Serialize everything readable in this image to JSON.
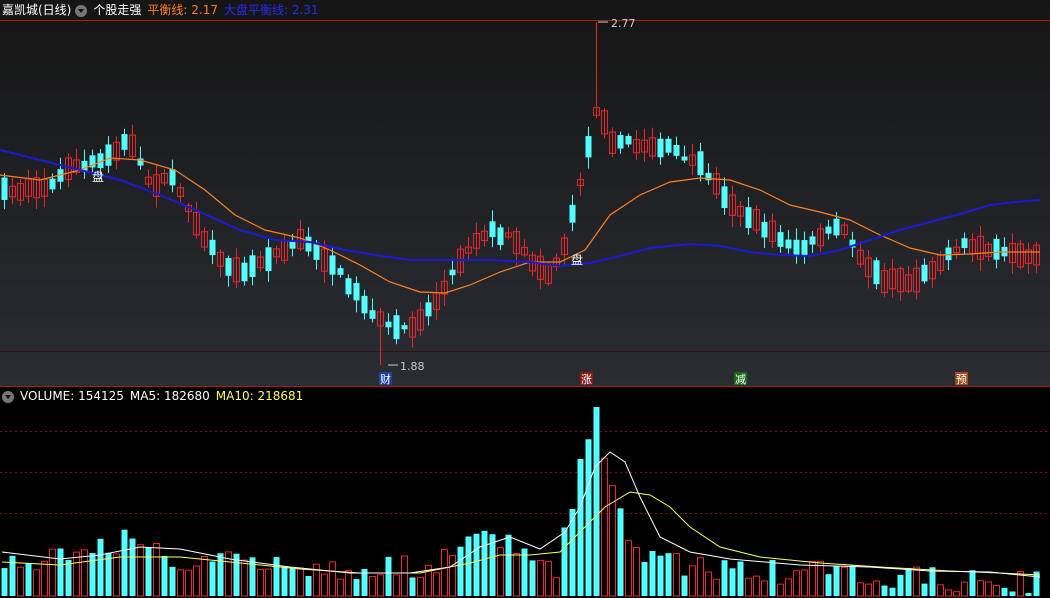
{
  "header": {
    "stock_name": "嘉凯城(日线)",
    "indicator_name": "个股走强",
    "balance_label": "平衡线: ",
    "balance_value": "2.17",
    "market_balance_label": "大盘平衡线: ",
    "market_balance_value": "2.31"
  },
  "volume_header": {
    "volume_label": "VOLUME: ",
    "volume_value": "154125",
    "ma5_label": "MA5: ",
    "ma5_value": "182680",
    "ma10_label": "MA10: ",
    "ma10_value": "218681"
  },
  "markers": {
    "pan_1": "盘",
    "pan_2": "盘",
    "high_label": "2.77",
    "low_label": "1.88",
    "cai": "财",
    "zhang": "涨",
    "jian": "减",
    "yu": "预"
  },
  "colors": {
    "up": "#e8262b",
    "down": "#54ffff",
    "ma_orange": "#ff7f1e",
    "ma_blue": "#1a1ad6",
    "vol_ma5": "#ffffff",
    "vol_ma10": "#ffff66",
    "frame": "#b01818"
  },
  "chart_data": [
    {
      "type": "candlestick",
      "price_range": [
        1.88,
        2.77
      ],
      "max_price": 2.77,
      "min_price": 1.88,
      "series": [
        {
          "name": "平衡线",
          "color": "#ff7f1e"
        },
        {
          "name": "大盘平衡线",
          "color": "#1a1ad6"
        }
      ]
    },
    {
      "type": "bar",
      "series": [
        {
          "name": "VOLUME",
          "last": 154125
        },
        {
          "name": "MA5",
          "last": 182680
        },
        {
          "name": "MA10",
          "last": 218681
        }
      ]
    }
  ]
}
